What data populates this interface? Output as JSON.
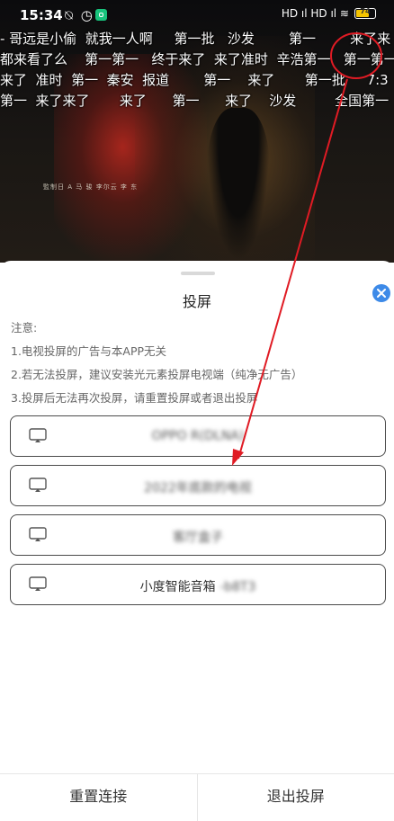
{
  "status_bar": {
    "time": "15:34",
    "left_icons": "⍉ ◷",
    "signal": "HD ıl HD ıl ≋",
    "battery": "74",
    "battery_level": 0.74
  },
  "danmaku_lines": [
    "- 哥远是小偷  就我一人啊     第一批   沙发        第一        来了来",
    "都来看了么    第一第一   终于来了  来了准时  辛浩第一   第一第一",
    "来了  准时  第一  秦安  报道        第一    来了       第一批     7:3",
    "第一  来了来了       来了      第一      来了    沙发         全国第一  来"
  ],
  "video_credits": "監制日 A    马 骏  李尔云  李 东",
  "sheet": {
    "title": "投屏",
    "notice": [
      "注意:",
      "1.电视投屏的广告与本APP无关",
      "2.若无法投屏，建议安装光元素投屏电视端（纯净无广告）",
      "3.投屏后无法再次投屏，请重置投屏或者退出投屏"
    ],
    "devices": [
      {
        "name": "",
        "obscured": "OPPO R(DLNA)"
      },
      {
        "name": "",
        "obscured": "2022年底款的电视"
      },
      {
        "name": "",
        "obscured": "客厅盒子"
      },
      {
        "name": "小度智能音箱",
        "obscured": "-b8T3"
      }
    ],
    "footer": {
      "reset": "重置连接",
      "exit": "退出投屏"
    }
  },
  "colors": {
    "annotation": "#e01b24",
    "close_button": "#3d8ae8",
    "device_border": "#4a4a4a"
  }
}
